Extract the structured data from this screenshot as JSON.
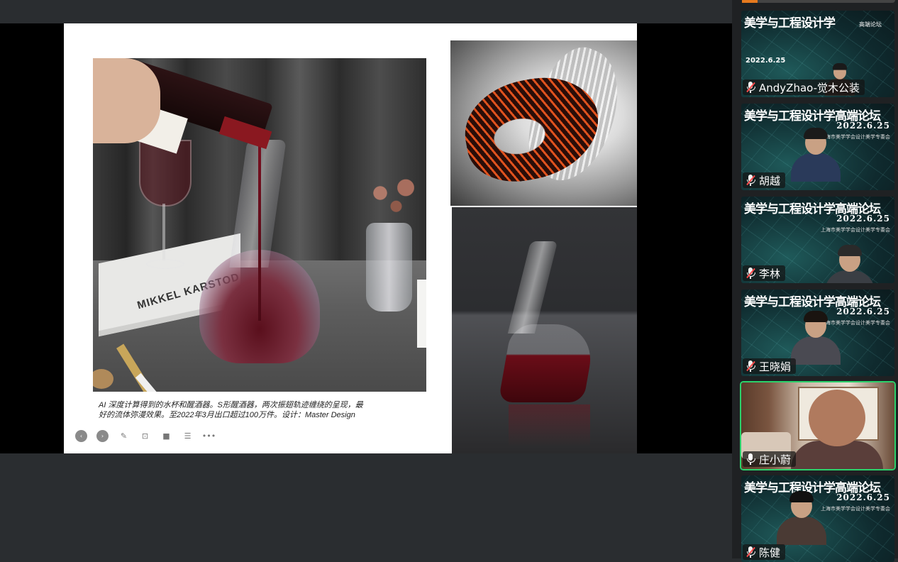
{
  "slide": {
    "book_title": "MIKKEL KARSTOD",
    "caption_line1": "AI 深度计算得到的水杯和醒酒器。S形醒酒器，两次振翅轨迹缠绕的呈现，最",
    "caption_line2": "好的流体弥漫效果。至2022年3月出口超过100万件。设计：Master Design",
    "toolbar": [
      {
        "name": "prev-slide",
        "icon": "chevron-left-icon",
        "glyph": "‹"
      },
      {
        "name": "next-slide",
        "icon": "chevron-right-icon",
        "glyph": "›"
      },
      {
        "name": "pen",
        "icon": "pen-icon",
        "glyph": "✎"
      },
      {
        "name": "zoom",
        "icon": "zoom-icon",
        "glyph": "⊡"
      },
      {
        "name": "video",
        "icon": "video-icon",
        "glyph": "■"
      },
      {
        "name": "notes",
        "icon": "notes-icon",
        "glyph": "☰"
      },
      {
        "name": "more",
        "icon": "more-icon",
        "glyph": "•••"
      }
    ]
  },
  "participants": [
    {
      "name": "AndyZhao-觉木公装",
      "muted": true,
      "speaking": false,
      "bg": "poster",
      "poster_title": "美学与工程设计学",
      "poster_sub": "高端论坛",
      "poster_date": "2022.6.25"
    },
    {
      "name": "胡越",
      "muted": true,
      "speaking": false,
      "bg": "forum",
      "forum_title": "美学与工程设计学高端论坛",
      "forum_date": "2022.6.25",
      "forum_org": "上海市美学学会设计美学专委会"
    },
    {
      "name": "李林",
      "muted": true,
      "speaking": false,
      "bg": "forum",
      "forum_title": "美学与工程设计学高端论坛",
      "forum_date": "2022.6.25",
      "forum_org": "上海市美学学会设计美学专委会"
    },
    {
      "name": "王晓娟",
      "muted": true,
      "speaking": false,
      "bg": "forum",
      "forum_title": "美学与工程设计学高端论坛",
      "forum_date": "2022.6.25",
      "forum_org": "上海市美学学会设计美学专委会"
    },
    {
      "name": "庄小蔚",
      "muted": false,
      "speaking": true,
      "bg": "room"
    },
    {
      "name": "陈健",
      "muted": true,
      "speaking": false,
      "bg": "forum",
      "forum_title": "美学与工程设计学高端论坛",
      "forum_date": "2022.6.25",
      "forum_org": "上海市美学学会设计美学专委会"
    }
  ],
  "colors": {
    "speaking_outline": "#2bd26b",
    "muted_slash": "#ff4b4b",
    "panel_bg": "#1f2123",
    "app_bg": "#2a2d30"
  }
}
